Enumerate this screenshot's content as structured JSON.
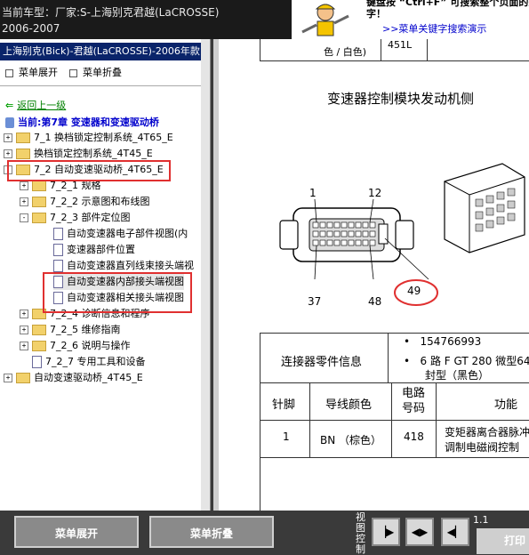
{
  "header": {
    "vehicle_line1": "当前车型：厂家:S-上海别克君越(LaCROSSE)",
    "vehicle_line2": "2006-2007"
  },
  "hint": {
    "line1": "键盘按 “Ctrl+F” 可搜索整个页面的关键",
    "line2": "字！",
    "link": ">>菜单关键字搜索演示"
  },
  "left": {
    "title": "上海别克(Bick)-君越(LaCROSSE)-2006年款",
    "expand_label": "菜单展开",
    "collapse_label": "菜单折叠",
    "back_label": "返回上一级",
    "current_label": "当前:第7章 变速器和变速驱动桥",
    "tree": [
      {
        "label": "7_1 换档锁定控制系统_4T65_E",
        "expander": "+"
      },
      {
        "label": "换档锁定控制系统_4T45_E",
        "expander": "+"
      },
      {
        "label": "7_2 自动变速驱动桥_4T65_E",
        "expander": "-"
      },
      {
        "label": "7_2_1 规格",
        "expander": "+"
      },
      {
        "label": "7_2_2 示意图和布线图",
        "expander": "+"
      },
      {
        "label": "7_2_3 部件定位图",
        "expander": "-"
      },
      {
        "label": "自动变速器电子部件视图(内"
      },
      {
        "label": "变速器部件位置"
      },
      {
        "label": "自动变速器直列线束接头端视"
      },
      {
        "label": "自动变速器内部接头端视图"
      },
      {
        "label": "自动变速器相关接头端视图"
      },
      {
        "label": "7_2_4 诊断信息和程序",
        "expander": "+"
      },
      {
        "label": "7_2_5 维修指南",
        "expander": "+"
      },
      {
        "label": "7_2_6 说明与操作",
        "expander": "+"
      },
      {
        "label": "7_2_7 专用工具和设备"
      },
      {
        "label": "自动变速驱动桥_4T45_E",
        "expander": "+"
      }
    ]
  },
  "doc": {
    "top_cell": "色 / 白色)",
    "top_cell2": "451L",
    "title": "变速器控制模块发动机侧",
    "pins": {
      "p1": "1",
      "p12": "12",
      "p37": "37",
      "p48": "48",
      "p49": "49"
    },
    "info_label": "连接器零件信息",
    "info_bullets": [
      "154766993",
      "6 路 F GT 280 微型64",
      "封型（黑色）"
    ],
    "col_pin": "针脚",
    "col_wire": "导线颜色",
    "col_circuit": "电路号码",
    "col_func": "功能",
    "row1": {
      "pin": "1",
      "wire": "BN （棕色）",
      "circuit": "418",
      "func1": "变矩器离合器脉冲",
      "func2": "调制电磁阀控制"
    }
  },
  "bottom": {
    "expand_btn": "菜单展开",
    "collapse_btn": "菜单折叠",
    "view_label": "视图控制",
    "page_num": "1.1",
    "print_btn": "打印"
  }
}
